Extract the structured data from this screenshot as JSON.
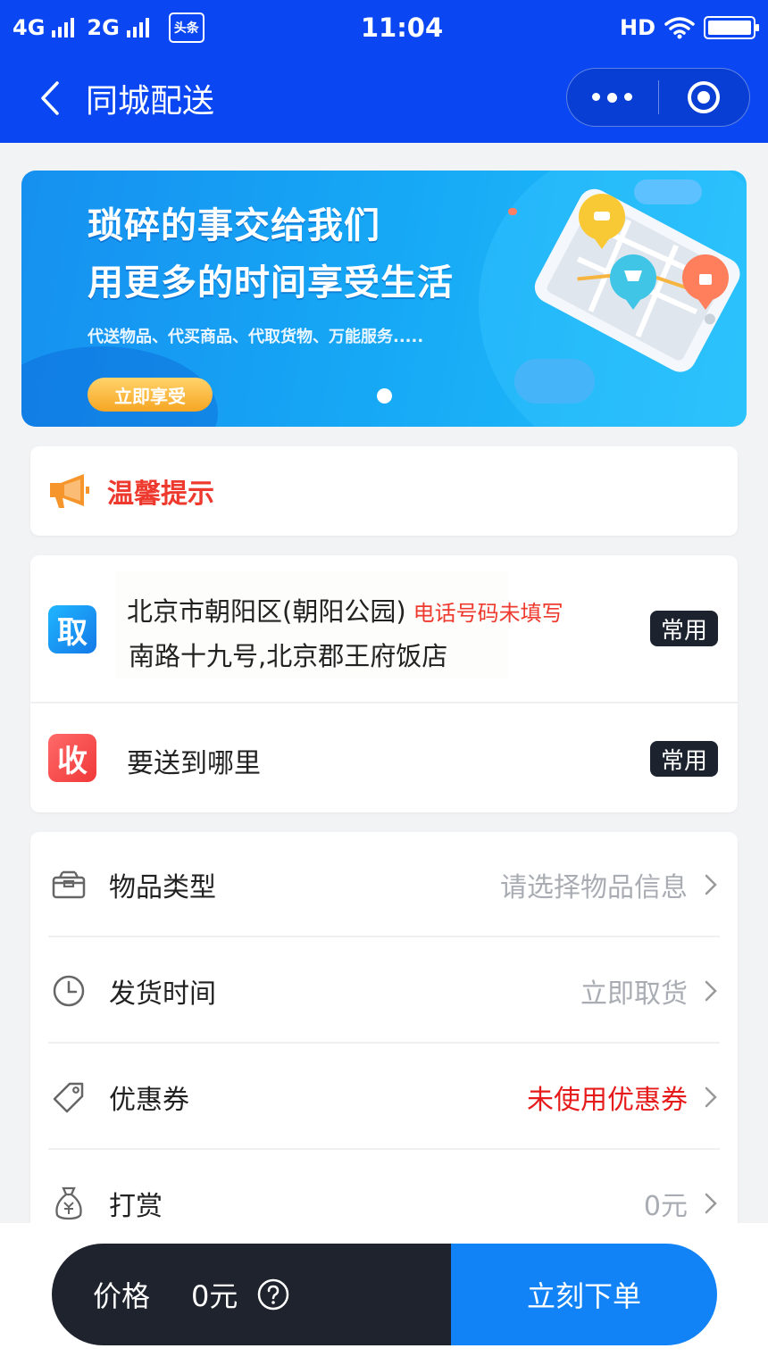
{
  "status_bar": {
    "network1": "4G",
    "network2": "2G",
    "app_badge": "头条",
    "time": "11:04",
    "hd": "HD"
  },
  "navbar": {
    "title": "同城配送"
  },
  "banner": {
    "headline_line1": "琐碎的事交给我们",
    "headline_line2": "用更多的时间享受生活",
    "subtitle": "代送物品、代买商品、代取货物、万能服务.....",
    "cta_label": "立即享受"
  },
  "tip": {
    "label": "温馨提示"
  },
  "pickup": {
    "badge": "取",
    "address_line1": "北京市朝阳区(朝阳公园)",
    "phone_warning": "电话号码未填写",
    "address_line2": "南路十九号,北京郡王府饭店",
    "tag": "常用"
  },
  "dropoff": {
    "badge": "收",
    "placeholder": "要送到哪里",
    "tag": "常用"
  },
  "options": [
    {
      "label": "物品类型",
      "value": "请选择物品信息",
      "icon": "box-icon"
    },
    {
      "label": "发货时间",
      "value": "立即取货",
      "icon": "clock-icon"
    },
    {
      "label": "优惠券",
      "value": "未使用优惠券",
      "icon": "tag-icon"
    },
    {
      "label": "打赏",
      "value": "0元",
      "icon": "money-bag-icon"
    }
  ],
  "order_bar": {
    "price_label": "价格",
    "price_value": "0元",
    "submit_label": "立刻下单"
  },
  "colors": {
    "header_blue": "#0a47f2",
    "accent_red": "#e61b1b",
    "order_blue": "#1283f7",
    "dark": "#1f232d"
  }
}
